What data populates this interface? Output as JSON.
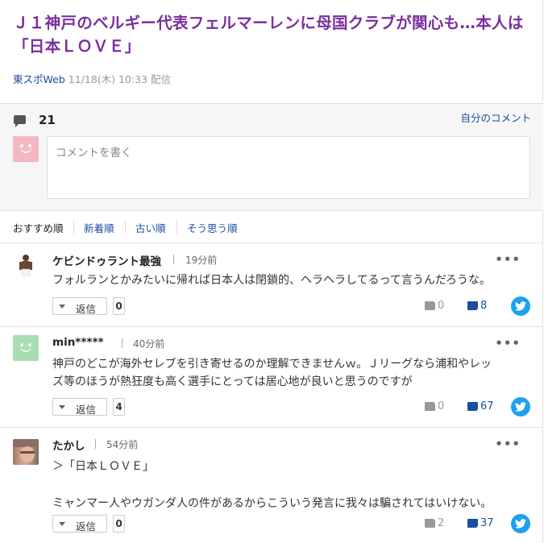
{
  "article": {
    "title": "Ｊ１神戸のベルギー代表フェルマーレンに母国クラブが関心も…本人は「日本ＬＯＶＥ」",
    "source": "東スポWeb",
    "datetime": "11/18(木) 10:33 配信"
  },
  "comments_header": {
    "count": "21",
    "my_comments_label": "自分のコメント",
    "input_placeholder": "コメントを書く"
  },
  "sort_tabs": [
    "おすすめ順",
    "新着順",
    "古い順",
    "そう思う順"
  ],
  "actions": {
    "reply_label": "返信",
    "more_label": "•••"
  },
  "comments": [
    {
      "user": "ケビンドゥラント最強",
      "time": "19分前",
      "lines": [
        "フォルランとかみたいに帰れば日本人は閉鎖的、ヘラヘラしてるって言うんだろうな。"
      ],
      "replies": "0",
      "up": "0",
      "down": "8"
    },
    {
      "user": "min*****",
      "time": "40分前",
      "lines": [
        "神戸のどこが海外セレブを引き寄せるのか理解できませんｗ。Ｊリーグなら浦和やレッ",
        "ズ等のほうが熱狂度も高く選手にとっては居心地が良いと思うのですが"
      ],
      "replies": "4",
      "up": "0",
      "down": "67"
    },
    {
      "user": "たかし",
      "time": "54分前",
      "lines": [
        "＞「日本ＬＯＶＥ」",
        "",
        "ミャンマー人やウガンダ人の件があるからこういう発言に我々は騙されてはいけない。"
      ],
      "replies": "0",
      "up": "2",
      "down": "37"
    }
  ],
  "colors": {
    "title": "#7a2f9e",
    "link": "#1a4ea0",
    "twitter": "#1da1f2"
  }
}
